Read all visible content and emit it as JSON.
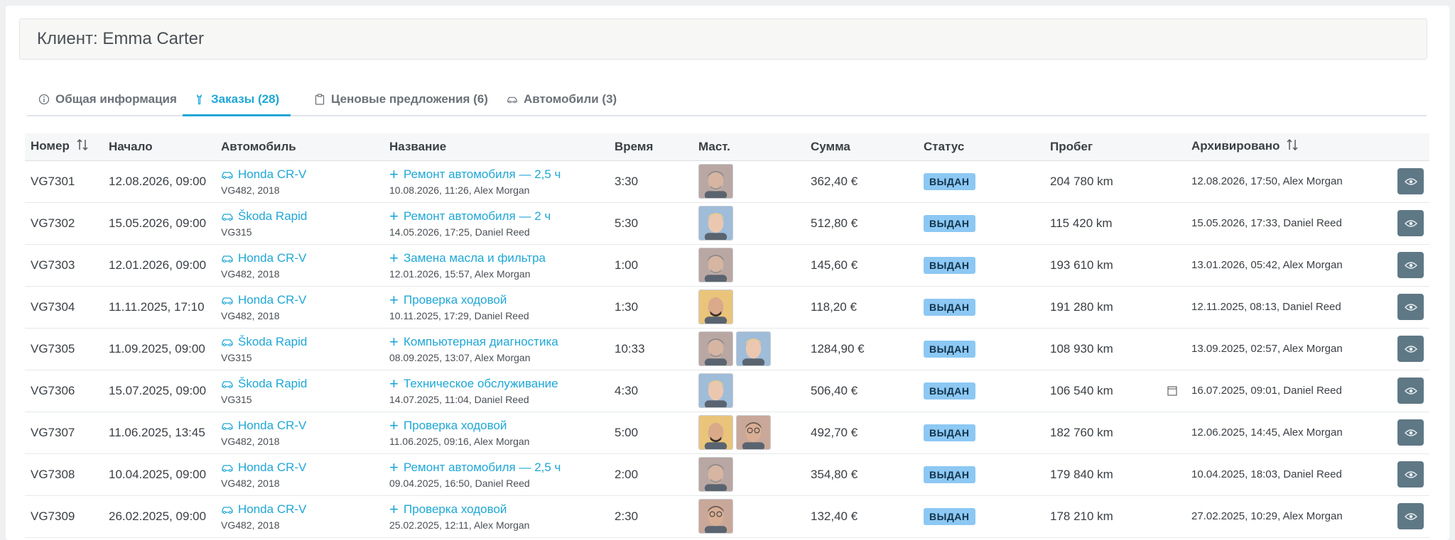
{
  "client": {
    "title": "Клиент: Emma Carter"
  },
  "tabs": [
    {
      "label": "Общая информация",
      "icon": "info-icon"
    },
    {
      "label": "Заказы (28)",
      "icon": "wrench-icon",
      "active": true
    },
    {
      "label": "Ценовые предложения (6)",
      "icon": "clipboard-icon"
    },
    {
      "label": "Автомобили (3)",
      "icon": "car-icon"
    }
  ],
  "colors": {
    "accent": "#1fa7d6",
    "badge": "#8cc8f3",
    "eye_button": "#5f7885"
  },
  "table": {
    "headers": {
      "number": "Номер",
      "start": "Начало",
      "car": "Автомобиль",
      "name": "Название",
      "time": "Время",
      "masters": "Маст.",
      "sum": "Сумма",
      "status": "Статус",
      "mileage": "Пробег",
      "archived": "Архивировано"
    },
    "rows": [
      {
        "number": "VG7301",
        "start": "12.08.2026, 09:00",
        "car": "Honda CR-V",
        "car_sub": "VG482, 2018",
        "name": "Ремонт автомобиля — 2,5 ч",
        "name_sub": "10.08.2026, 11:26, Alex Morgan",
        "time": "3:30",
        "masters": [
          "gray"
        ],
        "sum": "362,40 €",
        "status": "ВЫДАН",
        "mileage": "204 780 km",
        "archived": "12.08.2026, 17:50, Alex Morgan"
      },
      {
        "number": "VG7302",
        "start": "15.05.2026, 09:00",
        "car": "Škoda Rapid",
        "car_sub": "VG315",
        "name": "Ремонт автомобиля — 2 ч",
        "name_sub": "14.05.2026, 17:25, Daniel Reed",
        "time": "5:30",
        "masters": [
          "blond"
        ],
        "sum": "512,80 €",
        "status": "ВЫДАН",
        "mileage": "115 420 km",
        "archived": "15.05.2026, 17:33, Daniel Reed"
      },
      {
        "number": "VG7303",
        "start": "12.01.2026, 09:00",
        "car": "Honda CR-V",
        "car_sub": "VG482, 2018",
        "name": "Замена масла и фильтра",
        "name_sub": "12.01.2026, 15:57, Alex Morgan",
        "time": "1:00",
        "masters": [
          "gray"
        ],
        "sum": "145,60 €",
        "status": "ВЫДАН",
        "mileage": "193 610 km",
        "archived": "13.01.2026, 05:42, Alex Morgan"
      },
      {
        "number": "VG7304",
        "start": "11.11.2025, 17:10",
        "car": "Honda CR-V",
        "car_sub": "VG482, 2018",
        "name": "Проверка ходовой",
        "name_sub": "10.11.2025, 17:29, Daniel Reed",
        "time": "1:30",
        "masters": [
          "bald"
        ],
        "sum": "118,20 €",
        "status": "ВЫДАН",
        "mileage": "191 280 km",
        "archived": "12.11.2025, 08:13, Daniel Reed"
      },
      {
        "number": "VG7305",
        "start": "11.09.2025, 09:00",
        "car": "Škoda Rapid",
        "car_sub": "VG315",
        "name": "Компьютерная диагностика",
        "name_sub": "08.09.2025, 13:07, Alex Morgan",
        "time": "10:33",
        "masters": [
          "gray",
          "blond"
        ],
        "sum": "1284,90 €",
        "status": "ВЫДАН",
        "mileage": "108 930 km",
        "archived": "13.09.2025, 02:57, Alex Morgan"
      },
      {
        "number": "VG7306",
        "start": "15.07.2025, 09:00",
        "car": "Škoda Rapid",
        "car_sub": "VG315",
        "name": "Техническое обслуживание",
        "name_sub": "14.07.2025, 11:04, Daniel Reed",
        "time": "4:30",
        "masters": [
          "blond"
        ],
        "sum": "506,40 €",
        "status": "ВЫДАН",
        "mileage": "106 540 km",
        "archived": "16.07.2025, 09:01, Daniel Reed",
        "calendar": true
      },
      {
        "number": "VG7307",
        "start": "11.06.2025, 13:45",
        "car": "Honda CR-V",
        "car_sub": "VG482, 2018",
        "name": "Проверка ходовой",
        "name_sub": "11.06.2025, 09:16, Alex Morgan",
        "time": "5:00",
        "masters": [
          "bald",
          "glasses"
        ],
        "sum": "492,70 €",
        "status": "ВЫДАН",
        "mileage": "182 760 km",
        "archived": "12.06.2025, 14:45, Alex Morgan"
      },
      {
        "number": "VG7308",
        "start": "10.04.2025, 09:00",
        "car": "Honda CR-V",
        "car_sub": "VG482, 2018",
        "name": "Ремонт автомобиля — 2,5 ч",
        "name_sub": "09.04.2025, 16:50, Daniel Reed",
        "time": "2:00",
        "masters": [
          "gray"
        ],
        "sum": "354,80 €",
        "status": "ВЫДАН",
        "mileage": "179 840 km",
        "archived": "10.04.2025, 18:03, Daniel Reed"
      },
      {
        "number": "VG7309",
        "start": "26.02.2025, 09:00",
        "car": "Honda CR-V",
        "car_sub": "VG482, 2018",
        "name": "Проверка ходовой",
        "name_sub": "25.02.2025, 12:11, Alex Morgan",
        "time": "2:30",
        "masters": [
          "glasses"
        ],
        "sum": "132,40 €",
        "status": "ВЫДАН",
        "mileage": "178 210 km",
        "archived": "27.02.2025, 10:29, Alex Morgan"
      }
    ]
  }
}
